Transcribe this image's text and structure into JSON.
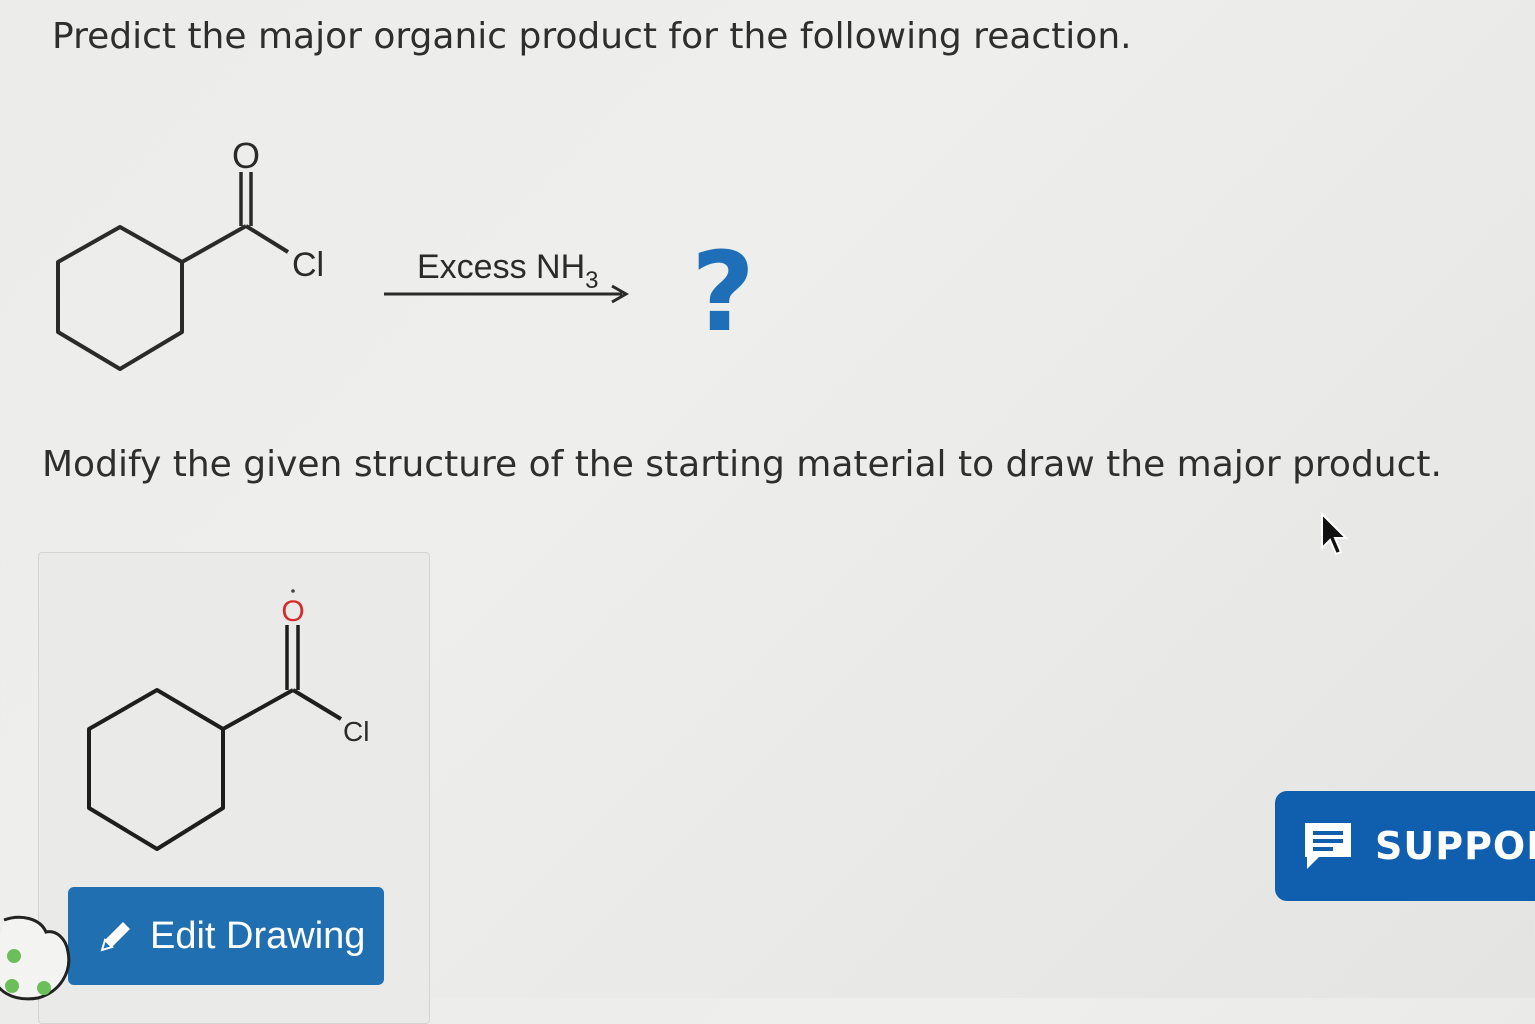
{
  "question": {
    "title": "Predict the major organic product for the following reaction."
  },
  "reaction": {
    "reactant_atoms": {
      "oxygen": "O",
      "chlorine": "Cl"
    },
    "reagent": "Excess NH",
    "reagent_subscript": "3",
    "product_placeholder": "?"
  },
  "instruction": "Modify the given structure of the starting material to draw the major product.",
  "drawing": {
    "atoms": {
      "oxygen": "O",
      "chlorine": "Cl"
    }
  },
  "buttons": {
    "edit_drawing": "Edit Drawing",
    "support": "SUPPOR"
  },
  "icons": {
    "edit": "pencil-icon",
    "support": "chat-icon",
    "cursor": "mouse-pointer-icon"
  },
  "colors": {
    "edit_button": "#1f6fb1",
    "support_button": "#0f5fae",
    "question_mark": "#1e6fb8",
    "oxygen_red": "#d62b2b"
  }
}
